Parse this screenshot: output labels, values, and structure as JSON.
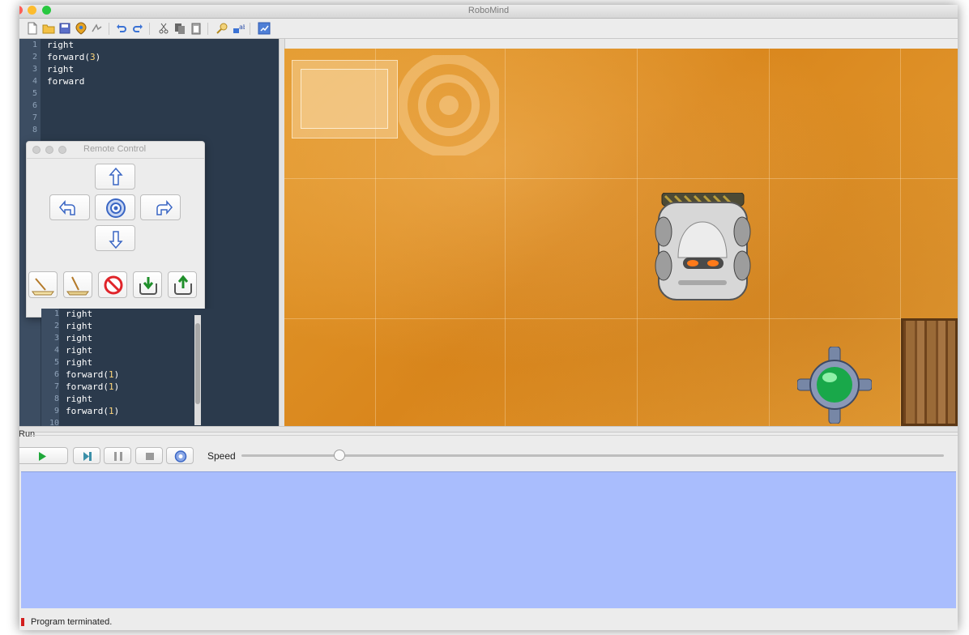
{
  "window": {
    "title": "RoboMind"
  },
  "toolbar": {
    "icons": [
      "new-file-icon",
      "open-folder-icon",
      "save-icon",
      "world-icon",
      "record-icon",
      "undo-icon",
      "redo-icon",
      "cut-icon",
      "copy-icon",
      "paste-icon",
      "find-icon",
      "replace-icon",
      "settings-icon"
    ]
  },
  "editor": {
    "line_numbers": [
      "1",
      "2",
      "3",
      "4",
      "5",
      "6",
      "7",
      "8"
    ],
    "lines": [
      {
        "cmd": "right",
        "arg": ""
      },
      {
        "cmd": "forward(",
        "arg": "3",
        "end": ")"
      },
      {
        "cmd": "right",
        "arg": ""
      },
      {
        "cmd": "forward",
        "arg": ""
      }
    ]
  },
  "remote_control": {
    "title": "Remote Control",
    "buttons": [
      "forward",
      "turn-left",
      "center",
      "turn-right",
      "backward"
    ],
    "tools": [
      "paint-white",
      "paint-black",
      "stop-paint",
      "pick-up",
      "put-down"
    ]
  },
  "recorded": {
    "line_numbers": [
      "1",
      "2",
      "3",
      "4",
      "5",
      "6",
      "7",
      "8",
      "9",
      "10"
    ],
    "lines": [
      {
        "cmd": "right",
        "arg": ""
      },
      {
        "cmd": "right",
        "arg": ""
      },
      {
        "cmd": "right",
        "arg": ""
      },
      {
        "cmd": "right",
        "arg": ""
      },
      {
        "cmd": "right",
        "arg": ""
      },
      {
        "cmd": "forward(",
        "arg": "1",
        "end": ")"
      },
      {
        "cmd": "forward(",
        "arg": "1",
        "end": ")"
      },
      {
        "cmd": "right",
        "arg": ""
      },
      {
        "cmd": "forward(",
        "arg": "1",
        "end": ")"
      },
      {
        "cmd": "",
        "arg": ""
      }
    ]
  },
  "run": {
    "label": "Run",
    "speed_label": "Speed",
    "speed_value": 0.14
  },
  "status": {
    "text": "Program terminated."
  }
}
